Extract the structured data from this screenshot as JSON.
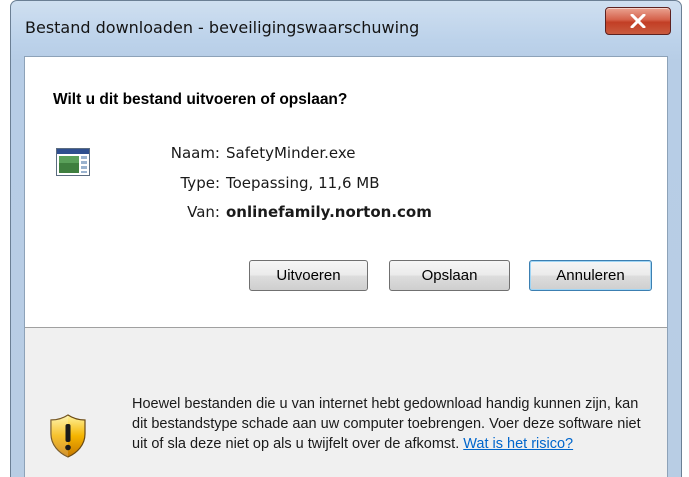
{
  "window": {
    "title": "Bestand downloaden - beveiligingswaarschuwing",
    "close_icon": "close-icon"
  },
  "main": {
    "question": "Wilt u dit bestand uitvoeren of opslaan?",
    "file_icon": "executable-file-icon",
    "fields": [
      {
        "label": "Naam:",
        "value": "SafetyMinder.exe"
      },
      {
        "label": "Type:",
        "value": "Toepassing, 11,6 MB"
      },
      {
        "label": "Van:",
        "value": "onlinefamily.norton.com"
      }
    ],
    "buttons": {
      "run": "Uitvoeren",
      "save": "Opslaan",
      "cancel": "Annuleren"
    }
  },
  "footer": {
    "icon": "security-shield-warning-icon",
    "warning_text": "Hoewel bestanden die u van internet hebt gedownload handig kunnen zijn, kan dit bestandstype schade aan uw computer toebrengen. Voer deze software niet uit of sla deze niet op als u twijfelt over de afkomst. ",
    "risk_link": "Wat is het risico?"
  },
  "colors": {
    "link": "#0066cc",
    "close_button": "#c23e25",
    "default_button_border": "#3c7fb1",
    "footer_background": "#f0f0f0"
  }
}
